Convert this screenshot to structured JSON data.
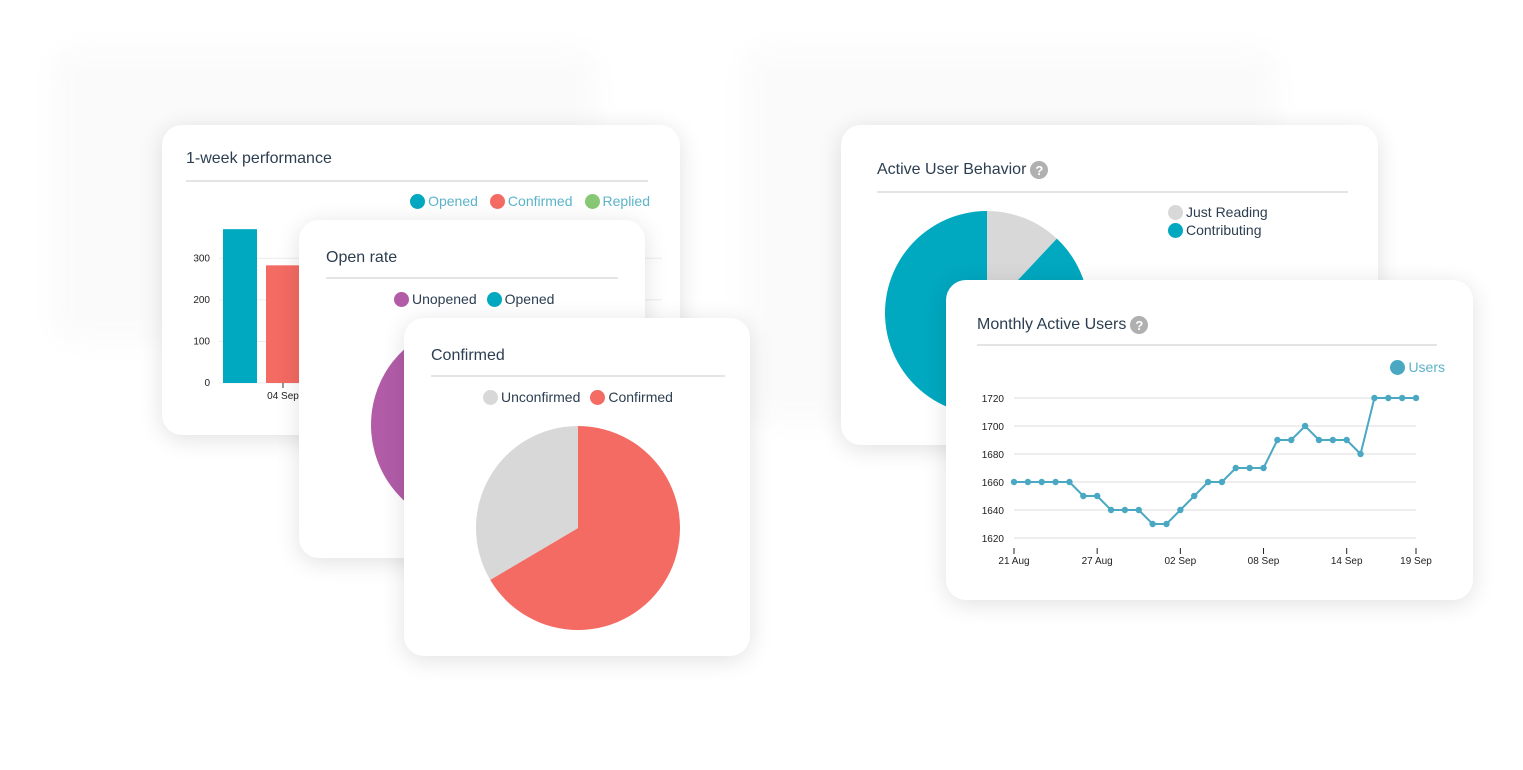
{
  "colors": {
    "teal": "#00a8c0",
    "coral": "#f36b63",
    "green": "#88c774",
    "purple": "#b25ca8",
    "gray": "#d8d8d8",
    "line": "#4aa8c3",
    "title": "#2c3e50",
    "legend_link": "#5bb4c9"
  },
  "help_icon_glyph": "?",
  "chart_data": [
    {
      "id": "weekly",
      "type": "bar",
      "title": "1-week performance",
      "legend": [
        "Opened",
        "Confirmed",
        "Replied"
      ],
      "legend_placement": "top-right",
      "categories": [
        "04 Sep"
      ],
      "series": [
        {
          "name": "Opened",
          "values": [
            370
          ]
        },
        {
          "name": "Confirmed",
          "values": [
            283
          ]
        }
      ],
      "yticks": [
        0,
        100,
        200,
        300
      ],
      "ylim": [
        0,
        380
      ],
      "grid": true
    },
    {
      "id": "openrate",
      "type": "pie",
      "title": "Open rate",
      "legend": [
        "Unopened",
        "Opened"
      ],
      "legend_placement": "top",
      "slices": [
        {
          "label": "Unopened",
          "value": 70
        },
        {
          "label": "Opened",
          "value": 30
        }
      ]
    },
    {
      "id": "confirmed",
      "type": "pie",
      "title": "Confirmed",
      "legend": [
        "Unconfirmed",
        "Confirmed"
      ],
      "legend_placement": "top",
      "slices": [
        {
          "label": "Confirmed",
          "value": 66.5
        },
        {
          "label": "Unconfirmed",
          "value": 33.5
        }
      ]
    },
    {
      "id": "behavior",
      "type": "pie",
      "title": "Active User Behavior",
      "legend": [
        "Just Reading",
        "Contributing"
      ],
      "legend_placement": "top-right",
      "slices": [
        {
          "label": "Just Reading",
          "value": 12
        },
        {
          "label": "Contributing",
          "value": 88
        }
      ]
    },
    {
      "id": "mau",
      "type": "line",
      "title": "Monthly Active Users",
      "legend": [
        "Users"
      ],
      "legend_placement": "top-right",
      "x": [
        "21 Aug",
        "22 Aug",
        "23 Aug",
        "24 Aug",
        "25 Aug",
        "26 Aug",
        "27 Aug",
        "28 Aug",
        "29 Aug",
        "30 Aug",
        "31 Aug",
        "01 Sep",
        "02 Sep",
        "03 Sep",
        "04 Sep",
        "05 Sep",
        "06 Sep",
        "07 Sep",
        "08 Sep",
        "09 Sep",
        "10 Sep",
        "11 Sep",
        "12 Sep",
        "13 Sep",
        "14 Sep",
        "15 Sep",
        "16 Sep",
        "17 Sep",
        "18 Sep",
        "19 Sep"
      ],
      "series": [
        {
          "name": "Users",
          "values": [
            1660,
            1660,
            1660,
            1660,
            1660,
            1650,
            1650,
            1640,
            1640,
            1640,
            1630,
            1630,
            1640,
            1650,
            1660,
            1660,
            1670,
            1670,
            1670,
            1690,
            1690,
            1700,
            1690,
            1690,
            1690,
            1680,
            1720,
            1720,
            1720,
            1720
          ]
        }
      ],
      "xticks": [
        "21 Aug",
        "27 Aug",
        "02 Sep",
        "08 Sep",
        "14 Sep",
        "19 Sep"
      ],
      "yticks": [
        1620,
        1640,
        1660,
        1680,
        1700,
        1720
      ],
      "ylim": [
        1612,
        1720
      ],
      "grid": true
    }
  ]
}
